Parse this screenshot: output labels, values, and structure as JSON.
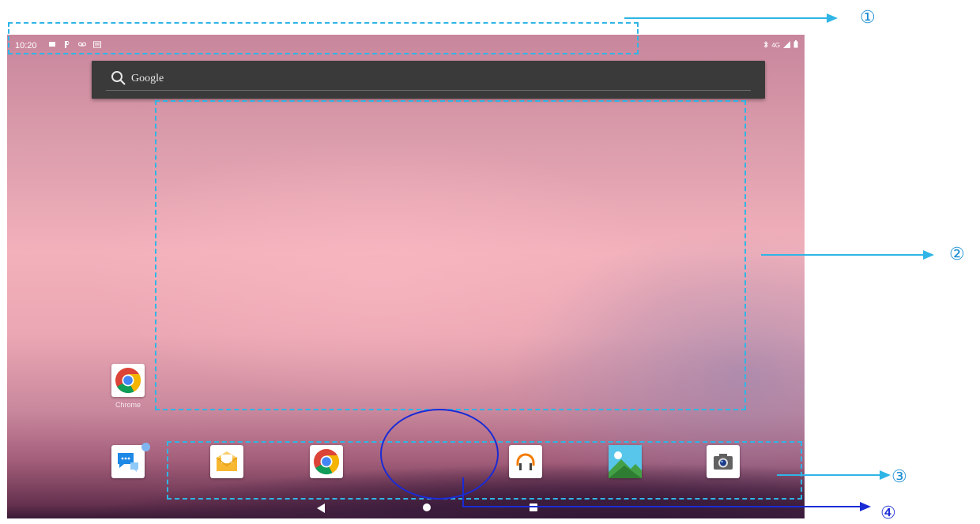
{
  "status_bar": {
    "time": "10:20",
    "left_icons": [
      "message-icon",
      "p-icon",
      "voicemail-icon",
      "keyboard-icon"
    ],
    "right_text": "4G",
    "right_icons": [
      "bluetooth-icon",
      "signal-icon",
      "battery-icon"
    ]
  },
  "search": {
    "label": "Google"
  },
  "apps": {
    "chrome_home": {
      "label": "Chrome",
      "icon": "chrome-icon"
    },
    "dock": [
      {
        "icon": "messaging-icon"
      },
      {
        "icon": "email-icon"
      },
      {
        "icon": "chrome-icon"
      },
      {
        "icon": "headphones-icon"
      },
      {
        "icon": "gallery-icon"
      },
      {
        "icon": "camera-icon"
      }
    ]
  },
  "navigation": [
    "back-icon",
    "home-icon",
    "recents-icon"
  ],
  "annotations": {
    "one": "①",
    "two": "②",
    "three": "③",
    "four": "④"
  },
  "colors": {
    "annotation": "#2fb5e6",
    "circle": "#1a2bd6"
  }
}
